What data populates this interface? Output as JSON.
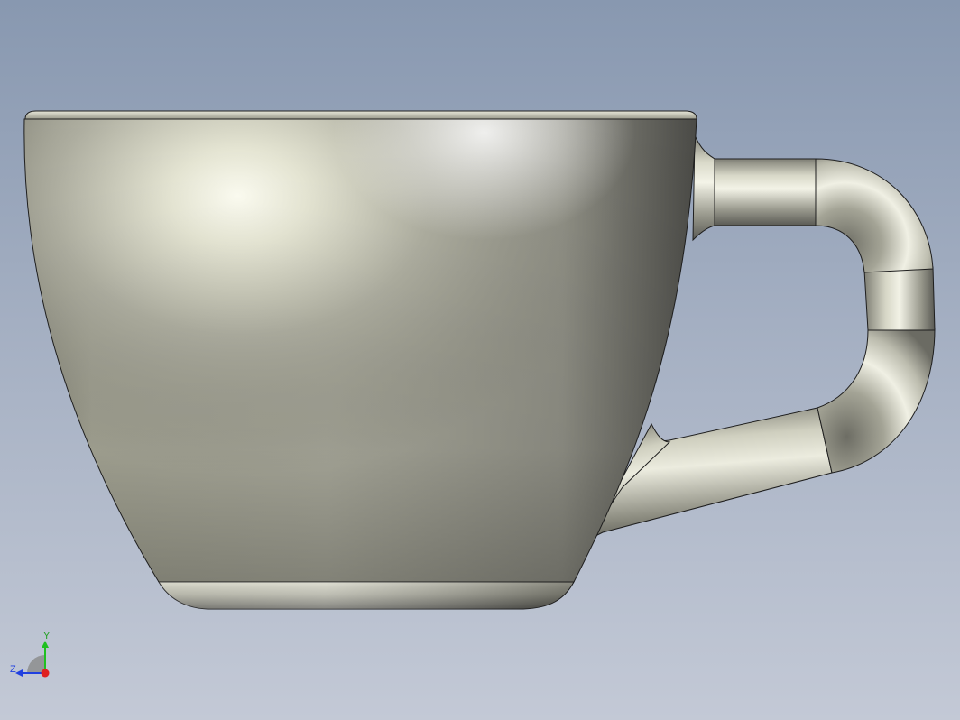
{
  "triad": {
    "x_label": "",
    "y_label": "Y",
    "z_label": "Z"
  },
  "colors": {
    "background_top": "#8898b0",
    "background_bottom": "#c3c9d6",
    "model_base": "#9a9a86",
    "model_highlight": "#fbfbef",
    "edge": "#1e1e1e",
    "axis_x": "#e02020",
    "axis_y": "#20c020",
    "axis_z": "#2040e0"
  },
  "model": {
    "name_icon": "coffee-cup-model",
    "parts": [
      "cup-body",
      "cup-rim",
      "cup-foot",
      "cup-handle"
    ]
  }
}
